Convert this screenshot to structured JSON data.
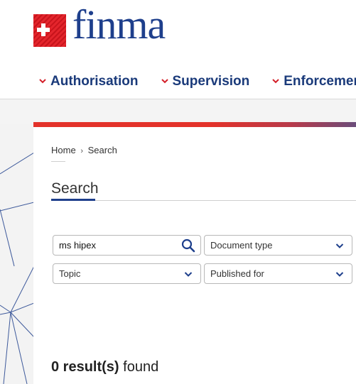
{
  "brand": {
    "name": "finma"
  },
  "nav": {
    "items": [
      {
        "label": "Authorisation"
      },
      {
        "label": "Supervision"
      },
      {
        "label": "Enforcement"
      }
    ]
  },
  "breadcrumb": {
    "home": "Home",
    "separator": "›",
    "current": "Search"
  },
  "page": {
    "title": "Search"
  },
  "search": {
    "value": "ms hipex"
  },
  "filters": {
    "document_type": "Document type",
    "topic": "Topic",
    "published_for": "Published for"
  },
  "results": {
    "count": "0 result(s)",
    "suffix": "found"
  },
  "colors": {
    "brand_blue": "#1e3f8c",
    "accent_red": "#e3322a"
  },
  "icons": {
    "search": "search-icon",
    "chevron": "chevron-down-icon",
    "flag": "swiss-cross-icon"
  }
}
